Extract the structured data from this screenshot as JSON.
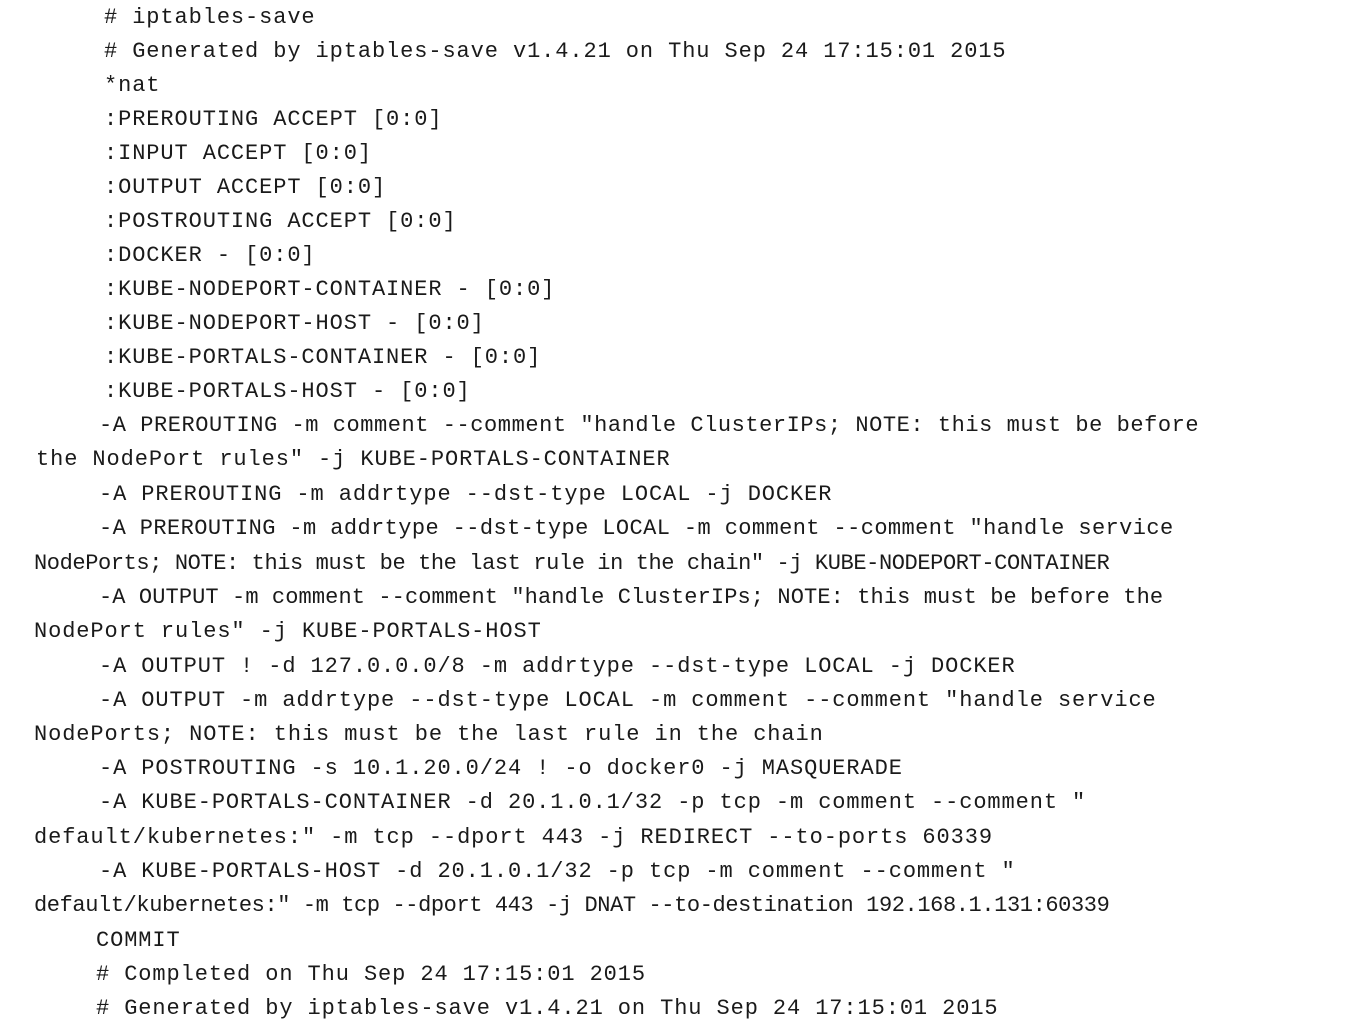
{
  "document": {
    "lines": [
      "# iptables-save",
      "# Generated by iptables-save v1.4.21 on Thu Sep 24 17:15:01 2015",
      "*nat",
      ":PREROUTING ACCEPT [0:0]",
      ":INPUT ACCEPT [0:0]",
      ":OUTPUT ACCEPT [0:0]",
      ":POSTROUTING ACCEPT [0:0]",
      ":DOCKER - [0:0]",
      ":KUBE-NODEPORT-CONTAINER - [0:0]",
      ":KUBE-NODEPORT-HOST - [0:0]",
      ":KUBE-PORTALS-CONTAINER - [0:0]",
      ":KUBE-PORTALS-HOST - [0:0]",
      "-A PREROUTING -m comment --comment \"handle ClusterIPs; NOTE: this must be before",
      "the NodePort rules\" -j KUBE-PORTALS-CONTAINER",
      "-A PREROUTING -m addrtype --dst-type LOCAL -j DOCKER",
      "-A PREROUTING -m addrtype --dst-type LOCAL -m comment --comment \"handle service",
      "NodePorts; NOTE: this must be the last rule in the chain\" -j KUBE-NODEPORT-CONTAINER",
      "-A OUTPUT -m comment --comment \"handle ClusterIPs; NOTE: this must be before the",
      "NodePort rules\" -j KUBE-PORTALS-HOST",
      "-A OUTPUT ! -d 127.0.0.0/8 -m addrtype --dst-type LOCAL -j DOCKER",
      "-A OUTPUT -m addrtype --dst-type LOCAL -m comment --comment \"handle service",
      "NodePorts; NOTE: this must be the last rule in the chain",
      "-A POSTROUTING -s 10.1.20.0/24 ! -o docker0 -j MASQUERADE",
      "-A KUBE-PORTALS-CONTAINER -d 20.1.0.1/32 -p tcp -m comment --comment \"",
      "default/kubernetes:\" -m tcp --dport 443 -j REDIRECT --to-ports 60339",
      "-A KUBE-PORTALS-HOST -d 20.1.0.1/32 -p tcp -m comment --comment \"",
      "default/kubernetes:\" -m tcp --dport 443 -j DNAT --to-destination 192.168.1.131:60339",
      "COMMIT",
      "# Completed on Thu Sep 24 17:15:01 2015",
      "# Generated by iptables-save v1.4.21 on Thu Sep 24 17:15:01 2015"
    ]
  }
}
